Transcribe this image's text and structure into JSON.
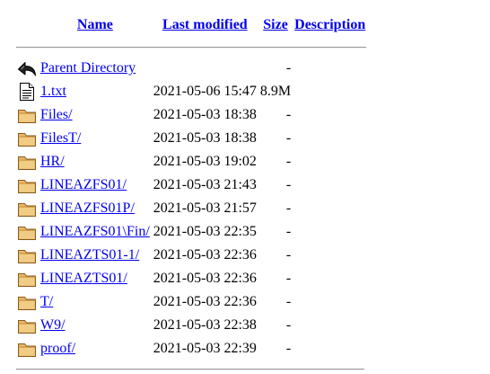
{
  "columns": {
    "name": "Name",
    "last_modified": "Last modified",
    "size": "Size",
    "description": "Description"
  },
  "entries": [
    {
      "icon": "back-arrow-icon",
      "name": "Parent Directory",
      "modified": "",
      "size": "-",
      "description": ""
    },
    {
      "icon": "text-file-icon",
      "name": "1.txt",
      "modified": "2021-05-06 15:47",
      "size": "8.9M",
      "description": ""
    },
    {
      "icon": "folder-icon",
      "name": "Files/",
      "modified": "2021-05-03 18:38",
      "size": "-",
      "description": ""
    },
    {
      "icon": "folder-icon",
      "name": "FilesT/",
      "modified": "2021-05-03 18:38",
      "size": "-",
      "description": ""
    },
    {
      "icon": "folder-icon",
      "name": "HR/",
      "modified": "2021-05-03 19:02",
      "size": "-",
      "description": ""
    },
    {
      "icon": "folder-icon",
      "name": "LINEAZFS01/",
      "modified": "2021-05-03 21:43",
      "size": "-",
      "description": ""
    },
    {
      "icon": "folder-icon",
      "name": "LINEAZFS01P/",
      "modified": "2021-05-03 21:57",
      "size": "-",
      "description": ""
    },
    {
      "icon": "folder-icon",
      "name": "LINEAZFS01\\Fin/",
      "modified": "2021-05-03 22:35",
      "size": "-",
      "description": ""
    },
    {
      "icon": "folder-icon",
      "name": "LINEAZTS01-1/",
      "modified": "2021-05-03 22:36",
      "size": "-",
      "description": ""
    },
    {
      "icon": "folder-icon",
      "name": "LINEAZTS01/",
      "modified": "2021-05-03 22:36",
      "size": "-",
      "description": ""
    },
    {
      "icon": "folder-icon",
      "name": "T/",
      "modified": "2021-05-03 22:36",
      "size": "-",
      "description": ""
    },
    {
      "icon": "folder-icon",
      "name": "W9/",
      "modified": "2021-05-03 22:38",
      "size": "-",
      "description": ""
    },
    {
      "icon": "folder-icon",
      "name": "proof/",
      "modified": "2021-05-03 22:39",
      "size": "-",
      "description": ""
    }
  ],
  "colors": {
    "link": "#0000ee",
    "folder_fill": "#e8b96a",
    "folder_stroke": "#8a5a1c",
    "rule": "#9a9a9a"
  }
}
